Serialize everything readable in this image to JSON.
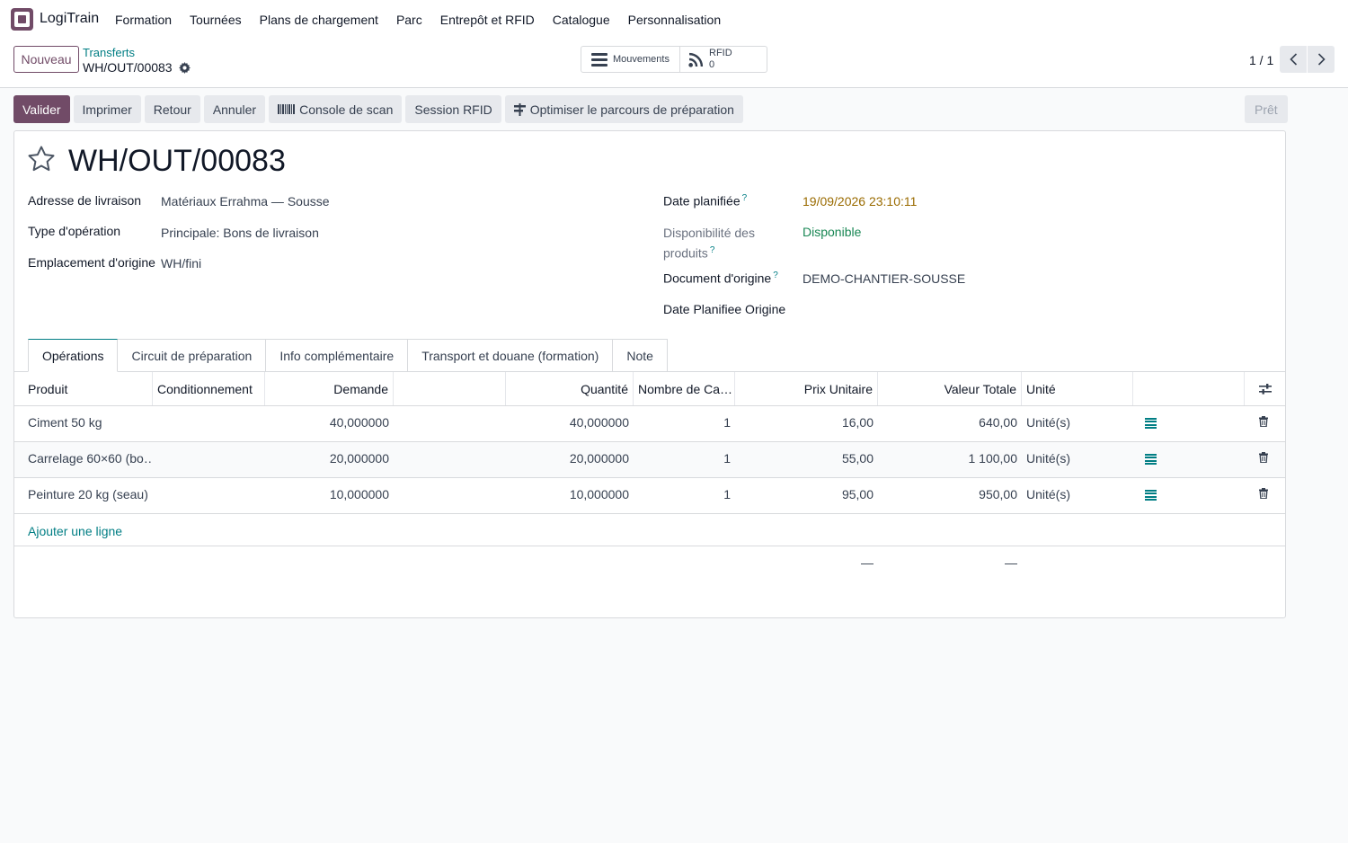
{
  "nav": {
    "app_name": "LogiTrain",
    "menu": [
      "Formation",
      "Tournées",
      "Plans de chargement",
      "Parc",
      "Entrepôt et RFID",
      "Catalogue",
      "Personnalisation"
    ]
  },
  "control": {
    "new_label": "Nouveau",
    "breadcrumb_parent": "Transferts",
    "breadcrumb_current": "WH/OUT/00083",
    "smart_mouvements": "Mouvements",
    "smart_rfid_label": "RFID",
    "smart_rfid_count": "0",
    "pager": "1 / 1"
  },
  "actions": {
    "validate": "Valider",
    "print": "Imprimer",
    "return": "Retour",
    "cancel": "Annuler",
    "scan_console": "Console de scan",
    "rfid_session": "Session RFID",
    "optimize": "Optimiser le parcours de préparation",
    "status": "Prêt"
  },
  "record": {
    "title": "WH/OUT/00083",
    "left_fields": {
      "address_label": "Adresse de livraison",
      "address_value": "Matériaux Errahma — Sousse",
      "optype_label": "Type d'opération",
      "optype_value": "Principale: Bons de livraison",
      "location_label": "Emplacement d'origine",
      "location_value": "WH/fini"
    },
    "right_fields": {
      "date_label": "Date planifiée",
      "date_value": "19/09/2026 23:10:11",
      "avail_label_1": "Disponibilité des",
      "avail_label_2": "produits",
      "avail_value": "Disponible",
      "origin_label": "Document d'origine",
      "origin_value": "DEMO-CHANTIER-SOUSSE",
      "origin_date_label": "Date Planifiee Origine"
    },
    "help_mark": "?"
  },
  "colors": {
    "brand": "#714b67",
    "link": "#017e84",
    "date_warning": "#9a6b00",
    "available": "#198754"
  },
  "tabs": [
    "Opérations",
    "Circuit de préparation",
    "Info complémentaire",
    "Transport et douane (formation)",
    "Note"
  ],
  "table": {
    "headers": {
      "product": "Produit",
      "packaging": "Conditionnement",
      "demand": "Demande",
      "quantity": "Quantité",
      "packages": "Nombre de Ca…",
      "unit_price": "Prix Unitaire",
      "total": "Valeur Totale",
      "uom": "Unité"
    },
    "rows": [
      {
        "product": "Ciment 50 kg",
        "demand": "40,000000",
        "quantity": "40,000000",
        "packages": "1",
        "unit_price": "16,00",
        "total": "640,00",
        "uom": "Unité(s)"
      },
      {
        "product": "Carrelage 60×60 (bo…",
        "demand": "20,000000",
        "quantity": "20,000000",
        "packages": "1",
        "unit_price": "55,00",
        "total": "1 100,00",
        "uom": "Unité(s)"
      },
      {
        "product": "Peinture 20 kg (seau)",
        "demand": "10,000000",
        "quantity": "10,000000",
        "packages": "1",
        "unit_price": "95,00",
        "total": "950,00",
        "uom": "Unité(s)"
      }
    ],
    "add_line": "Ajouter une ligne",
    "footer_dash_price": "—",
    "footer_dash_total": "—"
  }
}
